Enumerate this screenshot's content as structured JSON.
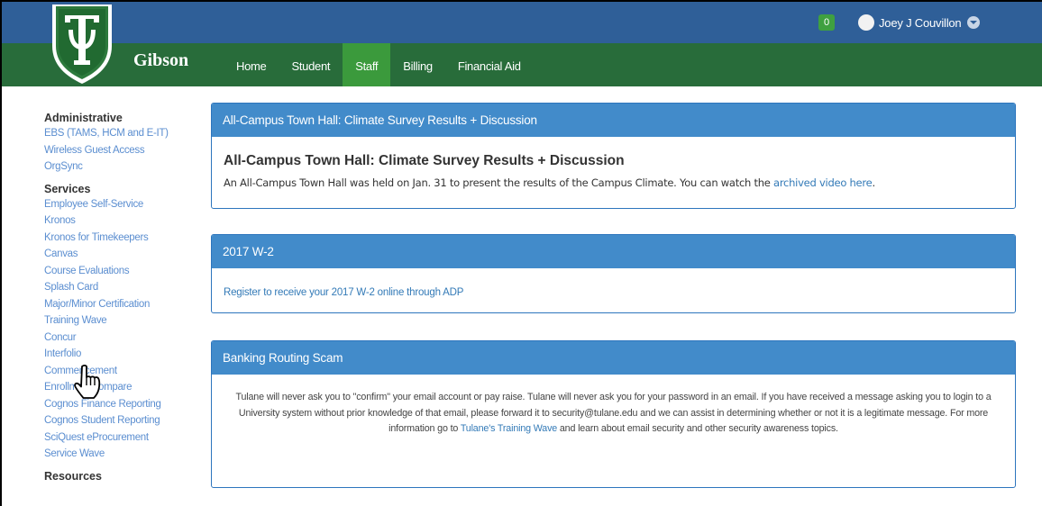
{
  "header": {
    "notification_count": "0",
    "user_name": "Joey J Couvillon"
  },
  "nav": {
    "brand": "Gibson",
    "items": [
      "Home",
      "Student",
      "Staff",
      "Billing",
      "Financial Aid"
    ],
    "active": "Staff"
  },
  "sidebar": {
    "administrative": {
      "heading": "Administrative",
      "links": [
        "EBS (TAMS, HCM and E-IT)",
        "Wireless Guest Access",
        "OrgSync"
      ]
    },
    "services": {
      "heading": "Services",
      "links": [
        "Employee Self-Service",
        "Kronos",
        "Kronos for Timekeepers",
        "Canvas",
        "Course Evaluations",
        "Splash Card",
        "Major/Minor Certification",
        "Training Wave",
        "Concur",
        "Interfolio",
        "Commencement",
        "EnrollmentCompare",
        "Cognos Finance Reporting",
        "Cognos Student Reporting",
        "SciQuest eProcurement",
        "Service Wave"
      ]
    },
    "resources": {
      "heading": "Resources"
    }
  },
  "panels": {
    "townhall": {
      "header": "All-Campus Town Hall: Climate Survey Results + Discussion",
      "title": "All-Campus Town Hall: Climate Survey Results + Discussion",
      "text": "An All-Campus Town Hall was held on Jan. 31 to present the results of the Campus Climate. You can watch the ",
      "link": "archived video here",
      "text_end": "."
    },
    "w2": {
      "header": "2017 W-2",
      "link": "Register to receive your 2017 W-2 online through ADP"
    },
    "scam": {
      "header": "Banking Routing Scam",
      "text_1": "Tulane will never ask you to \"confirm\" your email account or pay raise. Tulane will never ask you for your password in an email. If you have received a message asking you to login to a University system without prior knowledge of that email, please forward it to security@tulane.edu and we can assist in determining whether or not it is a legitimate message. For more information go to ",
      "link": "Tulane's Training Wave",
      "text_2": " and learn about email security and other security awareness topics."
    }
  },
  "colors": {
    "top_bar": "#2f5f98",
    "nav_bar": "#286c3a",
    "nav_active": "#3b9a3c",
    "panel_header": "#428bca",
    "link": "#5b8ed0"
  }
}
